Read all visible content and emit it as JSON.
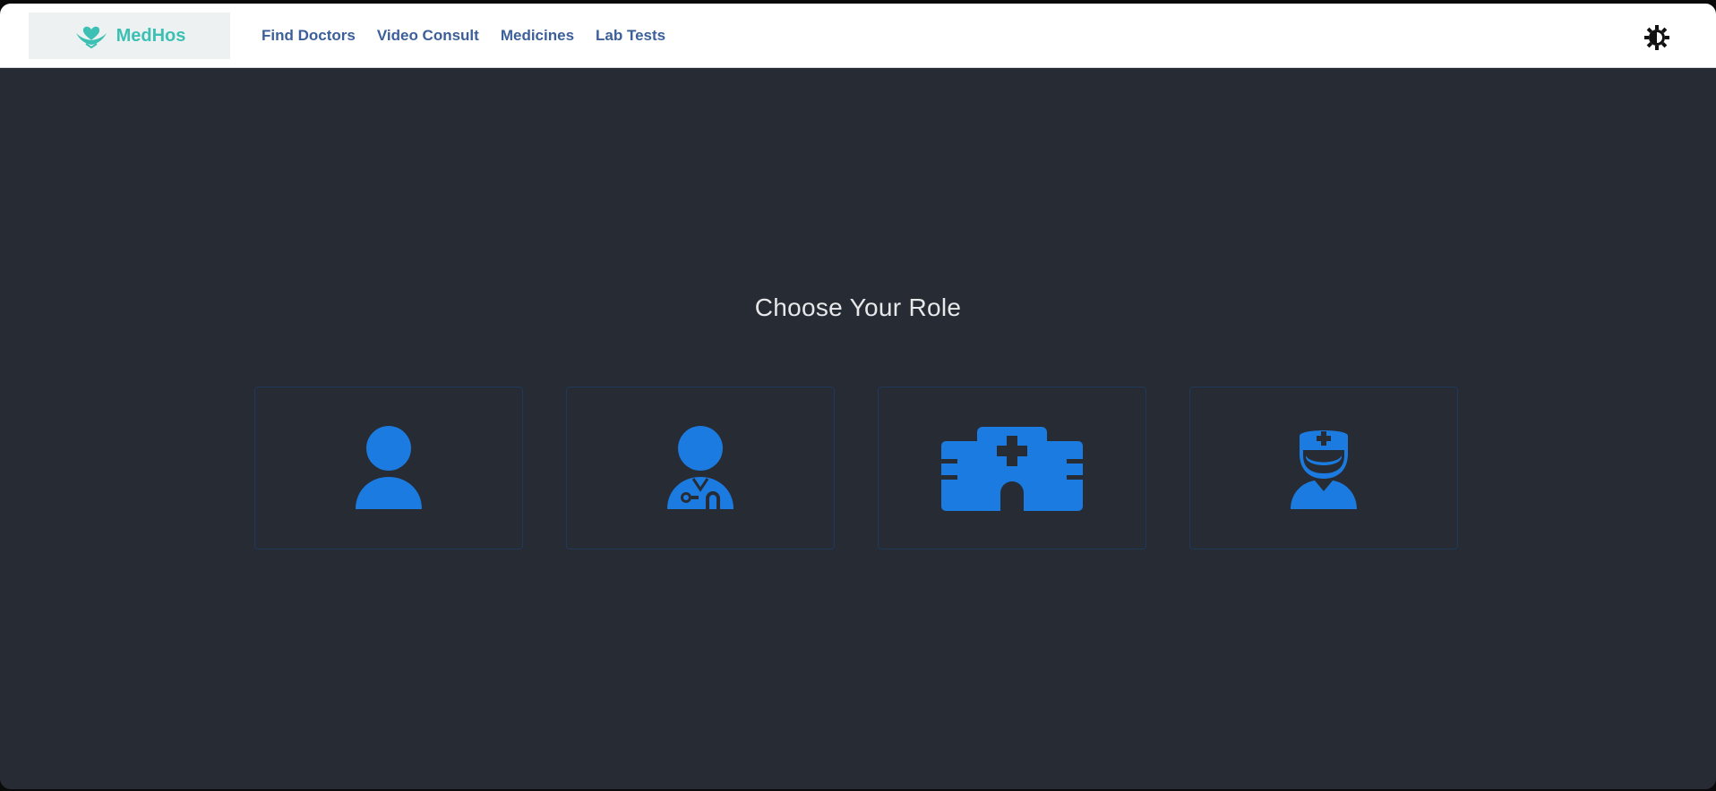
{
  "brand": {
    "name": "MedHos",
    "color": "#3cc0b4"
  },
  "nav": {
    "links": [
      "Find Doctors",
      "Video Consult",
      "Medicines",
      "Lab Tests"
    ],
    "color": "#3c5f9a"
  },
  "theme_toggle": {
    "icon": "contrast-icon"
  },
  "main": {
    "title": "Choose Your Role",
    "roles": [
      {
        "icon": "user-icon"
      },
      {
        "icon": "doctor-icon"
      },
      {
        "icon": "hospital-icon"
      },
      {
        "icon": "nurse-icon"
      }
    ]
  },
  "colors": {
    "background": "#272b33",
    "accent": "#1b7be0",
    "card_border": "#20385a"
  }
}
